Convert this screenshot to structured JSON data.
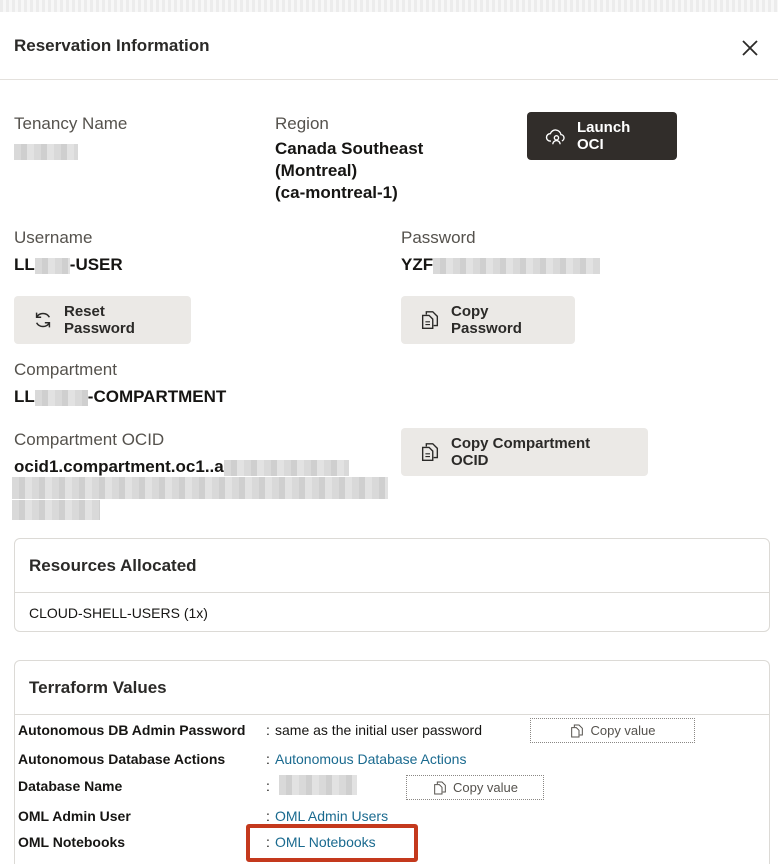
{
  "dialog": {
    "title": "Reservation Information"
  },
  "tenancy": {
    "label": "Tenancy Name"
  },
  "region": {
    "label": "Region",
    "value_line1": "Canada Southeast",
    "value_line2": "(Montreal)",
    "value_line3": "(ca-montreal-1)"
  },
  "launch_button": {
    "label": "Launch OCI"
  },
  "username": {
    "label": "Username",
    "prefix": "LL",
    "suffix": "-USER"
  },
  "password": {
    "label": "Password",
    "prefix": "YZF"
  },
  "reset_password_button": {
    "label": "Reset Password"
  },
  "copy_password_button": {
    "label": "Copy Password"
  },
  "compartment": {
    "label": "Compartment",
    "prefix": "LL",
    "suffix": "-COMPARTMENT"
  },
  "compartment_ocid": {
    "label": "Compartment OCID",
    "prefix": "ocid1.compartment.oc1..a"
  },
  "copy_compartment_ocid_button": {
    "label": "Copy Compartment OCID"
  },
  "resources": {
    "title": "Resources Allocated",
    "items": [
      "CLOUD-SHELL-USERS (1x)"
    ]
  },
  "terraform": {
    "title": "Terraform Values",
    "rows": [
      {
        "key": "Autonomous DB Admin Password",
        "sep": ":",
        "value": "same as the initial user password",
        "copy": "Copy value"
      },
      {
        "key": "Autonomous Database Actions",
        "sep": ":",
        "link": "Autonomous Database Actions"
      },
      {
        "key": "Database Name",
        "sep": ":",
        "copy": "Copy value"
      },
      {
        "key": "OML Admin User",
        "sep": ":",
        "link": "OML Admin Users"
      },
      {
        "key": "OML Notebooks",
        "sep": ":",
        "link": "OML Notebooks"
      }
    ]
  },
  "colors": {
    "primary_dark": "#312d2a",
    "secondary_button": "#ebe9e6",
    "link": "#1a6a8f",
    "highlight": "#c4391d"
  },
  "icons": {
    "close": "close-icon",
    "launch": "cloud-user-icon",
    "reset": "refresh-icon",
    "copy": "copy-icon"
  }
}
